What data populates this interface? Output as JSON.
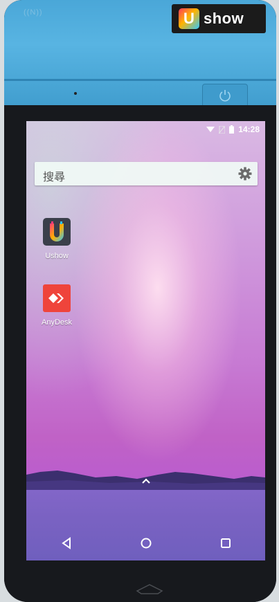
{
  "device": {
    "brand_letter": "U",
    "brand_name": "show",
    "nfc_mark": "((N))"
  },
  "status_bar": {
    "time": "14:28"
  },
  "search": {
    "label": "搜尋"
  },
  "apps": [
    {
      "label": "Ushow",
      "icon": "ushow-app-icon"
    },
    {
      "label": "AnyDesk",
      "icon": "anydesk-app-icon"
    }
  ],
  "colors": {
    "device_shell": "#4aa7d8",
    "bezel": "#17191d",
    "anydesk_red": "#ef443b",
    "ushow_dark": "#3a3f4a"
  },
  "nav": {
    "back_icon": "back-triangle-icon",
    "home_icon": "home-circle-icon",
    "recents_icon": "recents-square-icon"
  }
}
